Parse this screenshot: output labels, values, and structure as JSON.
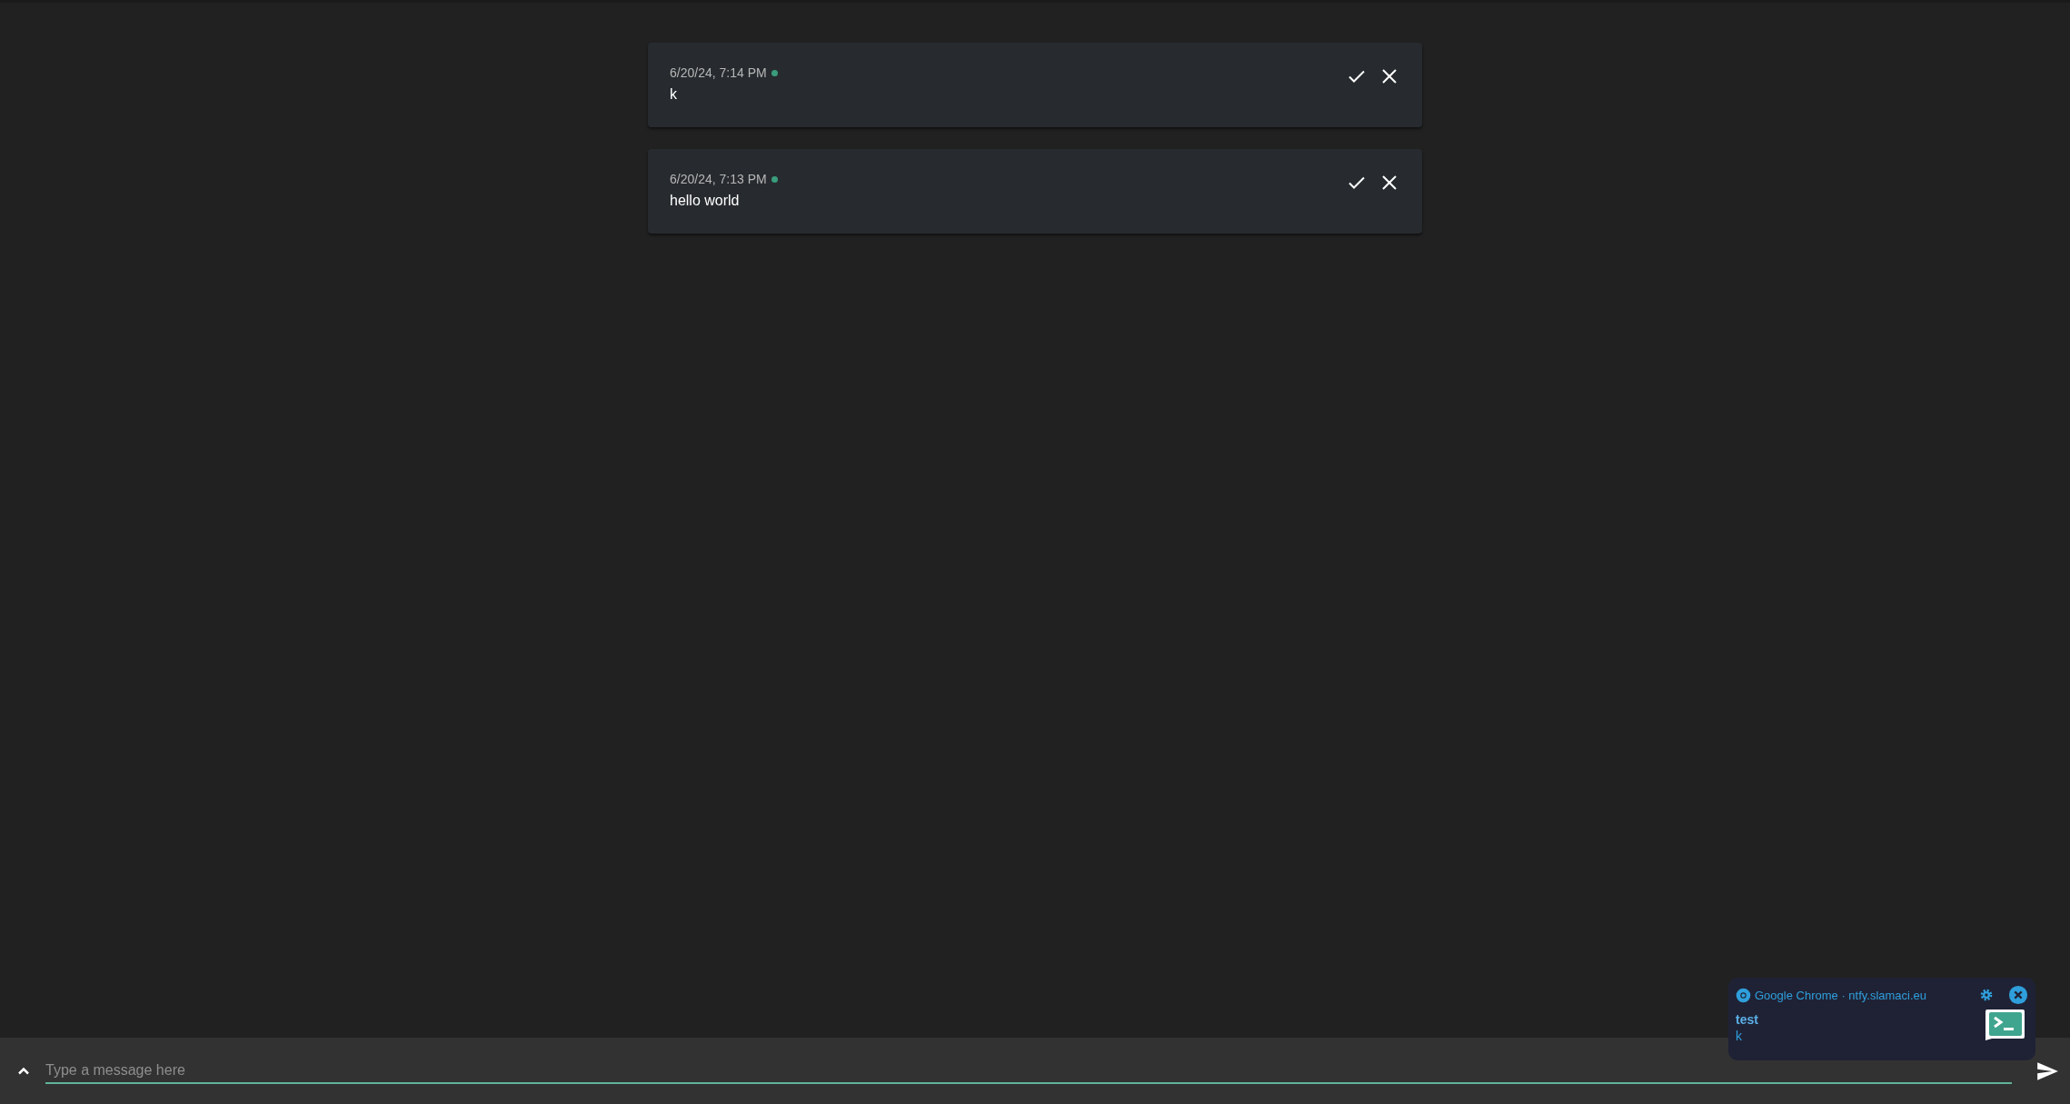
{
  "messages": [
    {
      "time": "6/20/24, 7:14 PM",
      "new": true,
      "text": "k"
    },
    {
      "time": "6/20/24, 7:13 PM",
      "new": true,
      "text": "hello world"
    }
  ],
  "composer": {
    "placeholder": "Type a message here"
  },
  "notification": {
    "source": "Google Chrome · ntfy.slamaci.eu",
    "title": "test",
    "body": "k"
  }
}
